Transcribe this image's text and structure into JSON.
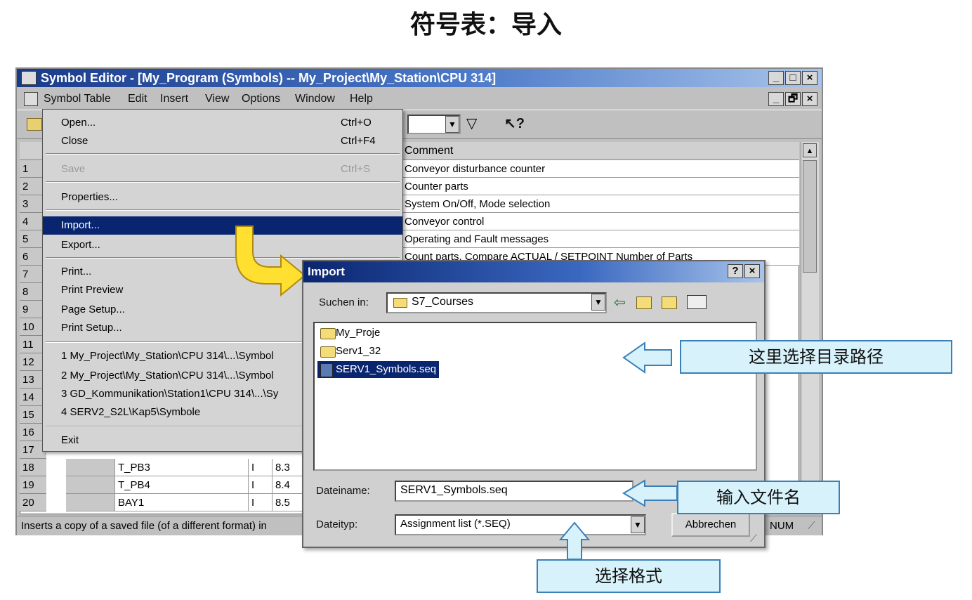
{
  "page_title": "符号表：导入",
  "window": {
    "title": "Symbol Editor - [My_Program (Symbols) -- My_Project\\My_Station\\CPU 314]",
    "controls": [
      "_",
      "□",
      "×"
    ],
    "doc_controls": [
      "_",
      "🗗",
      "×"
    ]
  },
  "menubar": [
    "Symbol Table",
    "Edit",
    "Insert",
    "View",
    "Options",
    "Window",
    "Help"
  ],
  "toolbar": {
    "filter_icon": "filter-icon",
    "help_icon": "context-help-icon"
  },
  "table": {
    "comment_header": "Comment",
    "row_numbers": [
      "1",
      "2",
      "3",
      "4",
      "5",
      "6",
      "7",
      "8",
      "9",
      "10",
      "11",
      "12",
      "13",
      "14",
      "15",
      "16",
      "17",
      "18",
      "19",
      "20"
    ],
    "comments": [
      "Conveyor disturbance counter",
      "Counter parts",
      "System On/Off, Mode selection",
      "Conveyor control",
      "Operating and Fault messages",
      "Count parts, Compare ACTUAL / SETPOINT Number of Parts"
    ],
    "visible_rows": [
      {
        "symbol": "T_PB3",
        "addr": "I",
        "num": "8.3"
      },
      {
        "symbol": "T_PB4",
        "addr": "I",
        "num": "8.4"
      },
      {
        "symbol": "BAY1",
        "addr": "I",
        "num": "8.5"
      }
    ]
  },
  "status_bar": {
    "text": "Inserts a copy of a saved file (of a different format) in",
    "num": "NUM"
  },
  "menu": {
    "items": [
      {
        "label": "Open...",
        "shortcut": "Ctrl+O"
      },
      {
        "label": "Close",
        "shortcut": "Ctrl+F4"
      },
      {
        "label": "Save",
        "shortcut": "Ctrl+S"
      },
      {
        "label": "Properties..."
      },
      {
        "label": "Import..."
      },
      {
        "label": "Export..."
      },
      {
        "label": "Print..."
      },
      {
        "label": "Print Preview"
      },
      {
        "label": "Page Setup..."
      },
      {
        "label": "Print Setup..."
      },
      {
        "label": "1 My_Project\\My_Station\\CPU 314\\...\\Symbol"
      },
      {
        "label": "2 My_Project\\My_Station\\CPU 314\\...\\Symbol"
      },
      {
        "label": "3 GD_Kommunikation\\Station1\\CPU 314\\...\\Sy"
      },
      {
        "label": "4 SERV2_S2L\\Kap5\\Symbole"
      },
      {
        "label": "Exit"
      }
    ]
  },
  "dialog": {
    "title": "Import",
    "controls": [
      "?",
      "×"
    ],
    "look_in_label": "Suchen in:",
    "look_in_value": "S7_Courses",
    "files": [
      "My_Proje",
      "Serv1_32",
      "SERV1_Symbols.seq"
    ],
    "filename_label": "Dateiname:",
    "filename_value": "SERV1_Symbols.seq",
    "filetype_label": "Dateityp:",
    "filetype_value": "Assignment list (*.SEQ)",
    "cancel_label": "Abbrechen"
  },
  "callouts": {
    "dir": "这里选择目录路径",
    "filename": "输入文件名",
    "format": "选择格式"
  },
  "colors": {
    "menu_highlight": "#0a2570",
    "callout_fill": "#d8f2fb",
    "callout_border": "#3a80b8",
    "arrow_yellow": "#ffe030"
  }
}
